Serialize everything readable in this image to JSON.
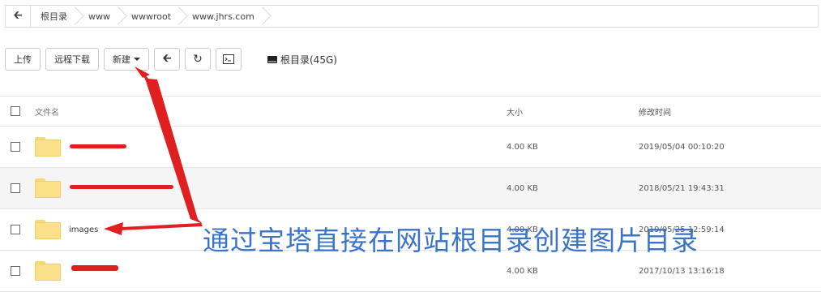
{
  "breadcrumb": {
    "back_icon": "arrow-left-icon",
    "items": [
      "根目录",
      "www",
      "wwwroot",
      "www.jhrs.com"
    ]
  },
  "toolbar": {
    "upload_label": "上传",
    "remote_download_label": "远程下载",
    "new_label": "新建",
    "back_icon": "arrow-left-icon",
    "refresh_icon": "refresh-icon",
    "terminal_icon": "terminal-icon",
    "disk_label": "根目录(45G)"
  },
  "table": {
    "headers": {
      "name": "文件名",
      "size": "大小",
      "modified": "修改时间"
    },
    "rows": [
      {
        "name": "",
        "size": "4.00 KB",
        "modified": "2019/05/04 00:10:20"
      },
      {
        "name": "",
        "size": "4.00 KB",
        "modified": "2018/05/21 19:43:31"
      },
      {
        "name": "images",
        "size": "4.00 KB",
        "modified": "2019/05/25 12:59:14"
      },
      {
        "name": "",
        "size": "4.00 KB",
        "modified": "2017/10/13 13:16:18"
      }
    ]
  },
  "annotation": {
    "text": "通过宝塔直接在网站根目录创建图片目录",
    "color": "#3b74c7"
  },
  "colors": {
    "arrow": "#e02020",
    "folder": "#fbe08a"
  }
}
